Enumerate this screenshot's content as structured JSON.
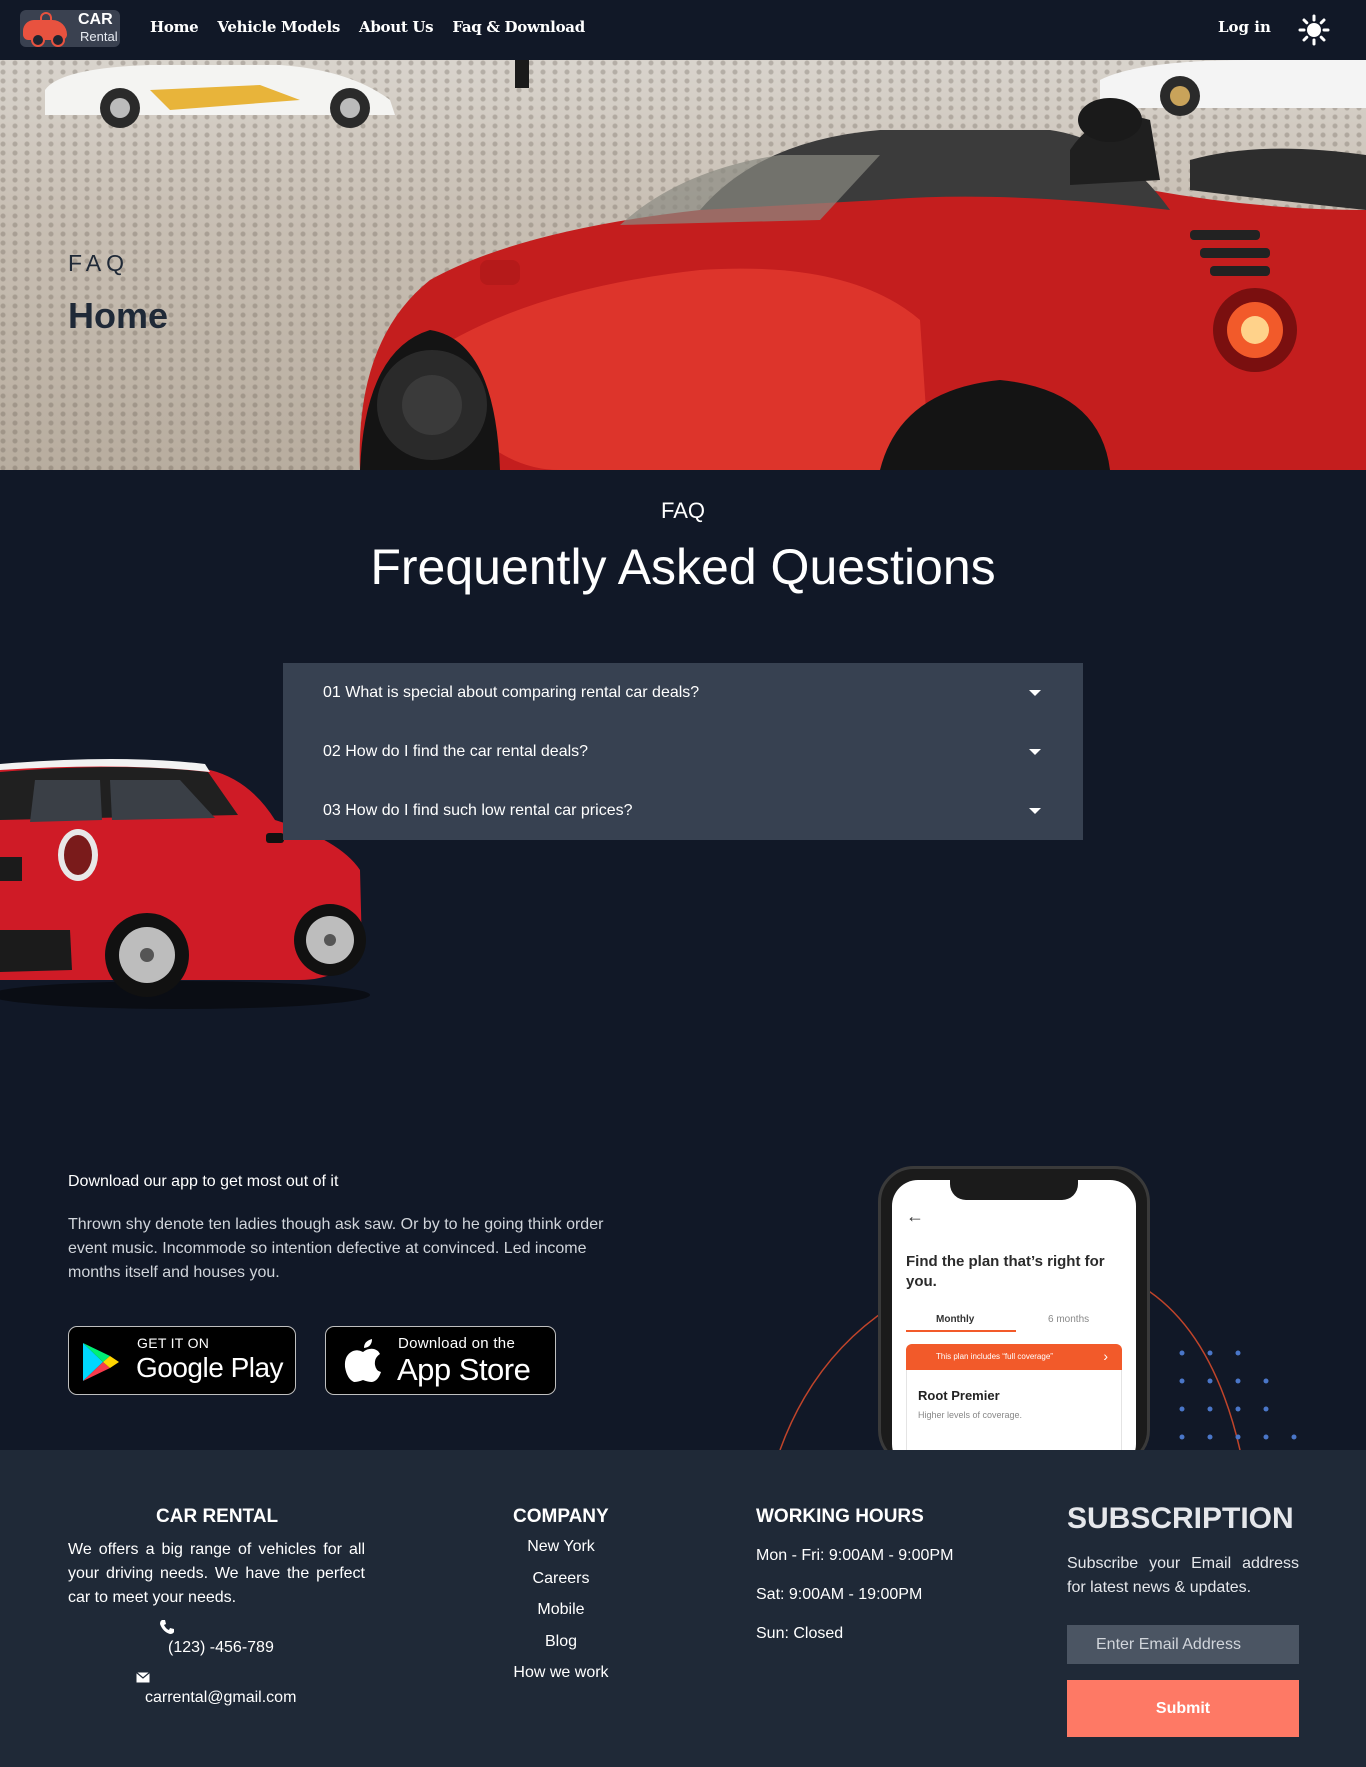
{
  "nav": {
    "logo_line1": "CAR",
    "logo_line2": "Rental",
    "links": [
      "Home",
      "Vehicle Models",
      "About Us",
      "Faq & Download"
    ],
    "login": "Log in",
    "theme_icon": "sun-icon"
  },
  "hero": {
    "label": "FAQ",
    "title": "Home"
  },
  "faq": {
    "label": "FAQ",
    "title": "Frequently Asked Questions",
    "items": [
      "01 What is special about comparing rental car deals?",
      "02 How do I find the car rental deals?",
      "03 How do I find such low rental car prices?"
    ],
    "toggle_icon": "caret-down-icon"
  },
  "download": {
    "heading": "Download our app to get most out of it",
    "body": "Thrown shy denote ten ladies though ask saw. Or by to he going think order event music. Incommode so intention defective at convinced. Led income months itself and houses you.",
    "google": {
      "small": "GET IT ON",
      "big": "Google Play"
    },
    "apple": {
      "small": "Download on the",
      "big": "App Store"
    },
    "phone": {
      "heading": "Find the plan that’s right for you.",
      "tab_active": "Monthly",
      "tab_other": "6 months",
      "banner": "This plan includes “full coverage”",
      "plan_name": "Root Premier",
      "plan_desc": "Higher levels of coverage."
    }
  },
  "footer": {
    "brand": {
      "title": "CAR RENTAL",
      "text": "We offers a big range of vehicles for all your driving needs. We have the perfect car to meet your needs.",
      "phone": "(123) -456-789",
      "email": "carrental@gmail.com"
    },
    "company": {
      "title": "COMPANY",
      "links": [
        "New York",
        "Careers",
        "Mobile",
        "Blog",
        "How we work"
      ]
    },
    "hours": {
      "title": "WORKING HOURS",
      "lines": [
        "Mon - Fri: 9:00AM - 9:00PM",
        "Sat: 9:00AM - 19:00PM",
        "Sun: Closed"
      ]
    },
    "subscription": {
      "title": "SUBSCRIPTION",
      "text": "Subscribe your Email address for latest news & updates.",
      "placeholder": "Enter Email Address",
      "button": "Submit"
    }
  },
  "colors": {
    "page_bg": "#111827",
    "footer_bg": "#1f2937",
    "accordion_bg": "#374151",
    "accent": "#fe7965"
  }
}
